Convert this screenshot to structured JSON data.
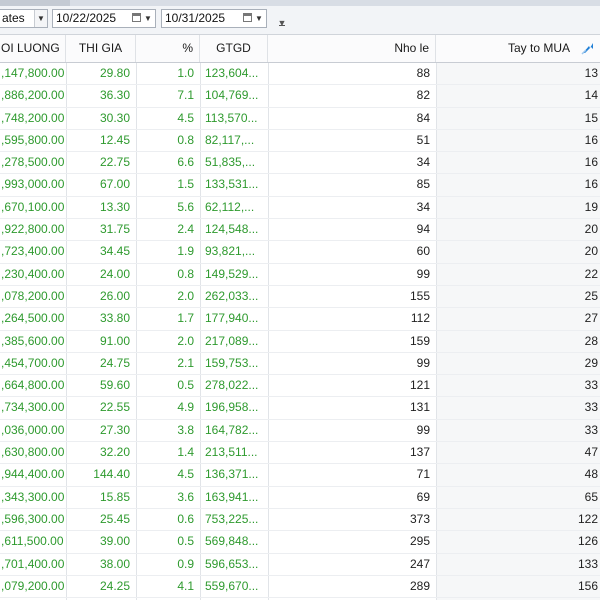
{
  "toolbar": {
    "mode_select": "ates",
    "from_date": "10/22/2025",
    "to_date": "10/31/2025"
  },
  "columns": {
    "khoi_luong": "OI LUONG",
    "thi_gia": "THI GIA",
    "pct": "%",
    "gtgd": "GTGD",
    "nho_le": "Nho le",
    "tay_to_mua": "Tay to MUA"
  },
  "rows": [
    {
      "kl": ",147,800.00",
      "tg": "29.80",
      "pct": "1.0",
      "gtgd": "123,604...",
      "nl": "88",
      "tt": "13"
    },
    {
      "kl": ",886,200.00",
      "tg": "36.30",
      "pct": "7.1",
      "gtgd": "104,769...",
      "nl": "82",
      "tt": "14"
    },
    {
      "kl": ",748,200.00",
      "tg": "30.30",
      "pct": "4.5",
      "gtgd": "113,570...",
      "nl": "84",
      "tt": "15"
    },
    {
      "kl": ",595,800.00",
      "tg": "12.45",
      "pct": "0.8",
      "gtgd": "82,117,...",
      "nl": "51",
      "tt": "16"
    },
    {
      "kl": ",278,500.00",
      "tg": "22.75",
      "pct": "6.6",
      "gtgd": "51,835,...",
      "nl": "34",
      "tt": "16"
    },
    {
      "kl": ",993,000.00",
      "tg": "67.00",
      "pct": "1.5",
      "gtgd": "133,531...",
      "nl": "85",
      "tt": "16"
    },
    {
      "kl": ",670,100.00",
      "tg": "13.30",
      "pct": "5.6",
      "gtgd": "62,112,...",
      "nl": "34",
      "tt": "19"
    },
    {
      "kl": ",922,800.00",
      "tg": "31.75",
      "pct": "2.4",
      "gtgd": "124,548...",
      "nl": "94",
      "tt": "20"
    },
    {
      "kl": ",723,400.00",
      "tg": "34.45",
      "pct": "1.9",
      "gtgd": "93,821,...",
      "nl": "60",
      "tt": "20"
    },
    {
      "kl": ",230,400.00",
      "tg": "24.00",
      "pct": "0.8",
      "gtgd": "149,529...",
      "nl": "99",
      "tt": "22"
    },
    {
      "kl": ",078,200.00",
      "tg": "26.00",
      "pct": "2.0",
      "gtgd": "262,033...",
      "nl": "155",
      "tt": "25"
    },
    {
      "kl": ",264,500.00",
      "tg": "33.80",
      "pct": "1.7",
      "gtgd": "177,940...",
      "nl": "112",
      "tt": "27"
    },
    {
      "kl": ",385,600.00",
      "tg": "91.00",
      "pct": "2.0",
      "gtgd": "217,089...",
      "nl": "159",
      "tt": "28"
    },
    {
      "kl": ",454,700.00",
      "tg": "24.75",
      "pct": "2.1",
      "gtgd": "159,753...",
      "nl": "99",
      "tt": "29"
    },
    {
      "kl": ",664,800.00",
      "tg": "59.60",
      "pct": "0.5",
      "gtgd": "278,022...",
      "nl": "121",
      "tt": "33"
    },
    {
      "kl": ",734,300.00",
      "tg": "22.55",
      "pct": "4.9",
      "gtgd": "196,958...",
      "nl": "131",
      "tt": "33"
    },
    {
      "kl": ",036,000.00",
      "tg": "27.30",
      "pct": "3.8",
      "gtgd": "164,782...",
      "nl": "99",
      "tt": "33"
    },
    {
      "kl": ",630,800.00",
      "tg": "32.20",
      "pct": "1.4",
      "gtgd": "213,511...",
      "nl": "137",
      "tt": "47"
    },
    {
      "kl": ",944,400.00",
      "tg": "144.40",
      "pct": "4.5",
      "gtgd": "136,371...",
      "nl": "71",
      "tt": "48"
    },
    {
      "kl": ",343,300.00",
      "tg": "15.85",
      "pct": "3.6",
      "gtgd": "163,941...",
      "nl": "69",
      "tt": "65"
    },
    {
      "kl": ",596,300.00",
      "tg": "25.45",
      "pct": "0.6",
      "gtgd": "753,225...",
      "nl": "373",
      "tt": "122"
    },
    {
      "kl": ",611,500.00",
      "tg": "39.00",
      "pct": "0.5",
      "gtgd": "569,848...",
      "nl": "295",
      "tt": "126"
    },
    {
      "kl": ",701,400.00",
      "tg": "38.00",
      "pct": "0.9",
      "gtgd": "596,653...",
      "nl": "247",
      "tt": "133"
    },
    {
      "kl": ",079,200.00",
      "tg": "24.25",
      "pct": "4.1",
      "gtgd": "559,670...",
      "nl": "289",
      "tt": "156"
    }
  ],
  "colors": {
    "value_green": "#2e9a2e",
    "value_black": "#1f1f1f",
    "sort_icon_blue": "#1f7fd6"
  },
  "icons": {
    "sort": "sort-ascending-icon",
    "calendar": "calendar-icon",
    "filter": "filter-icon",
    "dropdown": "chevron-down-icon"
  }
}
